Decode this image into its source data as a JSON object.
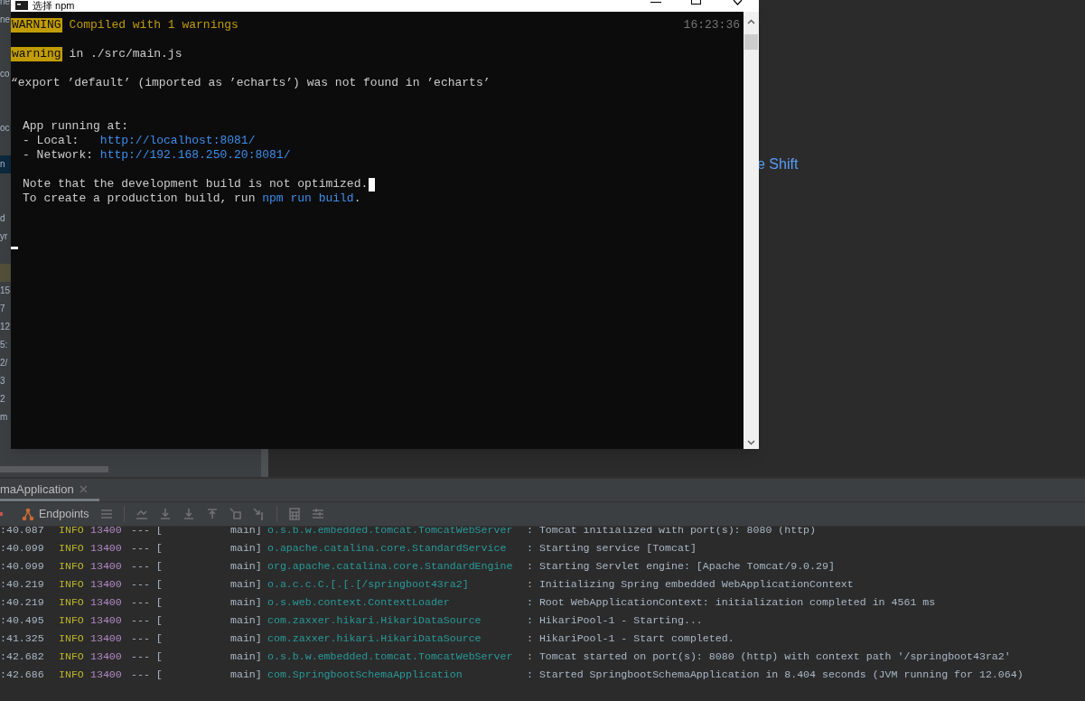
{
  "ide": {
    "left_rows": [
      {
        "kind": "text",
        "text": "ne",
        "selected": false
      },
      {
        "kind": "text",
        "text": "ne",
        "selected": false
      },
      {
        "kind": "blank"
      },
      {
        "kind": "blank"
      },
      {
        "kind": "text",
        "text": "co",
        "selected": false
      },
      {
        "kind": "blank"
      },
      {
        "kind": "blank"
      },
      {
        "kind": "text",
        "text": "oc",
        "selected": false
      },
      {
        "kind": "blank"
      },
      {
        "kind": "text",
        "text": "n",
        "selected": true
      },
      {
        "kind": "blank"
      },
      {
        "kind": "blank"
      },
      {
        "kind": "text",
        "text": "d",
        "selected": false
      },
      {
        "kind": "text",
        "text": "yr",
        "selected": false
      },
      {
        "kind": "blank"
      },
      {
        "kind": "marker"
      },
      {
        "kind": "text",
        "text": "15",
        "selected": false
      },
      {
        "kind": "text",
        "text": "7",
        "selected": false
      },
      {
        "kind": "text",
        "text": "12",
        "selected": false
      },
      {
        "kind": "text",
        "text": "5:",
        "selected": false
      },
      {
        "kind": "text",
        "text": "2/",
        "selected": false
      },
      {
        "kind": "text",
        "text": "3",
        "selected": false
      },
      {
        "kind": "text",
        "text": "2",
        "selected": false
      },
      {
        "kind": "text",
        "text": "m",
        "selected": false
      }
    ],
    "hint": "e Shift"
  },
  "console_window": {
    "title": "选择 npm",
    "timestamp": "16:23:36",
    "lines": [
      {
        "kind": "text",
        "segments": [
          {
            "kind": "badge",
            "text": "WARNING"
          },
          {
            "kind": "warn",
            "text": "Compiled with 1 warnings"
          }
        ]
      },
      {
        "kind": "blank"
      },
      {
        "kind": "text",
        "segments": [
          {
            "kind": "badge",
            "text": "warning"
          },
          {
            "kind": "plain",
            "text": "in ./src/main.js"
          }
        ]
      },
      {
        "kind": "blank"
      },
      {
        "kind": "text",
        "segments": [
          {
            "kind": "plain",
            "text": "“export ’default’ (imported as ’echarts’) was not found in ’echarts’"
          }
        ]
      },
      {
        "kind": "blank"
      },
      {
        "kind": "blank"
      },
      {
        "kind": "text",
        "indented": true,
        "segments": [
          {
            "kind": "plain",
            "text": "App running at:"
          }
        ]
      },
      {
        "kind": "text",
        "indented": true,
        "segments": [
          {
            "kind": "plain",
            "text": "- Local:   "
          },
          {
            "kind": "link",
            "text": "http://localhost:8081/"
          }
        ]
      },
      {
        "kind": "text",
        "indented": true,
        "segments": [
          {
            "kind": "plain",
            "text": "- Network: "
          },
          {
            "kind": "link",
            "text": "http://192.168.250.20:8081/"
          }
        ]
      },
      {
        "kind": "blank"
      },
      {
        "kind": "text",
        "indented": true,
        "cursor": true,
        "segments": [
          {
            "kind": "plain",
            "text": "Note that the development build is not optimized."
          }
        ]
      },
      {
        "kind": "text",
        "indented": true,
        "segments": [
          {
            "kind": "plain",
            "text": "To create a production build, run "
          },
          {
            "kind": "link",
            "text": "npm run build"
          },
          {
            "kind": "plain",
            "text": "."
          }
        ]
      },
      {
        "kind": "blank"
      },
      {
        "kind": "blank"
      },
      {
        "kind": "prompt"
      }
    ]
  },
  "run_panel": {
    "tab": {
      "label": "maApplication",
      "selected": true
    },
    "endpoints": "Endpoints",
    "log_rows": [
      {
        "time": ":40.087",
        "level": "INFO",
        "pid": "13400",
        "sep": "--- [",
        "thread": "main]",
        "logger": "o.s.b.w.embedded.tomcat.TomcatWebServer",
        "message": ": Tomcat initialized with port(s): 8080 (http)"
      },
      {
        "time": ":40.099",
        "level": "INFO",
        "pid": "13400",
        "sep": "--- [",
        "thread": "main]",
        "logger": "o.apache.catalina.core.StandardService",
        "message": ": Starting service [Tomcat]"
      },
      {
        "time": ":40.099",
        "level": "INFO",
        "pid": "13400",
        "sep": "--- [",
        "thread": "main]",
        "logger": "org.apache.catalina.core.StandardEngine",
        "message": ": Starting Servlet engine: [Apache Tomcat/9.0.29]"
      },
      {
        "time": ":40.219",
        "level": "INFO",
        "pid": "13400",
        "sep": "--- [",
        "thread": "main]",
        "logger": "o.a.c.c.C.[.[.[/springboot43ra2]",
        "message": ": Initializing Spring embedded WebApplicationContext"
      },
      {
        "time": ":40.219",
        "level": "INFO",
        "pid": "13400",
        "sep": "--- [",
        "thread": "main]",
        "logger": "o.s.web.context.ContextLoader",
        "message": ": Root WebApplicationContext: initialization completed in 4561 ms"
      },
      {
        "time": ":40.495",
        "level": "INFO",
        "pid": "13400",
        "sep": "--- [",
        "thread": "main]",
        "logger": "com.zaxxer.hikari.HikariDataSource",
        "message": ": HikariPool-1 - Starting..."
      },
      {
        "time": ":41.325",
        "level": "INFO",
        "pid": "13400",
        "sep": "--- [",
        "thread": "main]",
        "logger": "com.zaxxer.hikari.HikariDataSource",
        "message": ": HikariPool-1 - Start completed."
      },
      {
        "time": ":42.682",
        "level": "INFO",
        "pid": "13400",
        "sep": "--- [",
        "thread": "main]",
        "logger": "o.s.b.w.embedded.tomcat.TomcatWebServer",
        "message": ": Tomcat started on port(s): 8080 (http) with context path '/springboot43ra2'"
      },
      {
        "time": ":42.686",
        "level": "INFO",
        "pid": "13400",
        "sep": "--- [",
        "thread": "main]",
        "logger": "com.SpringbootSchemaApplication",
        "message": ": Started SpringbootSchemaApplication in 8.404 seconds (JVM running for 12.064)"
      }
    ]
  }
}
